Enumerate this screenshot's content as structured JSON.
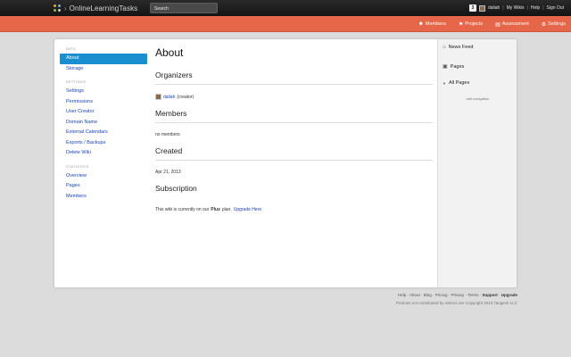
{
  "topbar": {
    "brand_name": "OnlineLearningTasks",
    "brand_separator": "›",
    "search_placeholder": "Search",
    "notifications_count": "3",
    "user_name": "daliah",
    "links": [
      "My Wikis",
      "Help",
      "Sign Out"
    ]
  },
  "navbar": {
    "items": [
      {
        "label": "Members",
        "icon": "members-icon"
      },
      {
        "label": "Projects",
        "icon": "projects-icon"
      },
      {
        "label": "Assessment",
        "icon": "assessment-icon"
      },
      {
        "label": "Settings",
        "icon": "gear-icon"
      }
    ]
  },
  "leftnav": {
    "info_head": "INFO",
    "info": [
      "About",
      "Storage"
    ],
    "settings_head": "SETTINGS",
    "settings": [
      "Settings",
      "Permissions",
      "User Creator",
      "Domain Name",
      "External Calendars",
      "Exports / Backups",
      "Delete Wiki"
    ],
    "statistics_head": "STATISTICS",
    "statistics": [
      "Overview",
      "Pages",
      "Members"
    ]
  },
  "content": {
    "title": "About",
    "organizers_heading": "Organizers",
    "organizer_name": "daliah",
    "organizer_role": "(creator)",
    "members_heading": "Members",
    "members_text": "no members",
    "created_heading": "Created",
    "created_date": "Apr 21, 2013",
    "subscription_heading": "Subscription",
    "subscription_prefix": "This wiki is currently on our",
    "subscription_plan": "Plus",
    "subscription_mid": "plan.",
    "subscription_link": "Upgrade Here"
  },
  "rightcol": {
    "news_feed": "News Feed",
    "pages": "Pages",
    "all_pages": "All Pages",
    "edit_navigation": "edit navigation"
  },
  "footer": {
    "links": [
      "Help",
      "About",
      "Blog",
      "Pricing",
      "Privacy",
      "Terms",
      "Support",
      "Upgrade"
    ],
    "copyright": "Portions not contributed by visitors are Copyright 2013 Tangient LLC"
  },
  "colors": {
    "nav_orange": "#e6664a",
    "active_blue": "#1a8fd0",
    "link_blue": "#1a44b8"
  }
}
